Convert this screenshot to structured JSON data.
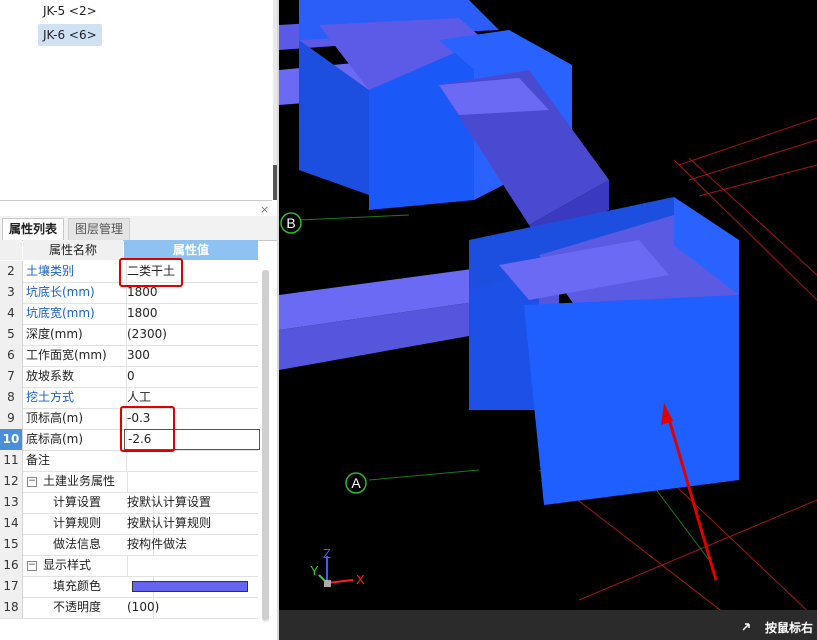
{
  "tree": {
    "items": [
      {
        "label": "JK-5 <2>",
        "selected": false
      },
      {
        "label": "JK-6 <6>",
        "selected": true
      }
    ]
  },
  "tabs": [
    {
      "label": "属性列表",
      "active": true
    },
    {
      "label": "图层管理",
      "active": false
    }
  ],
  "panel": {
    "close_icon": "×"
  },
  "table": {
    "header": {
      "name": "属性名称",
      "value": "属性值"
    },
    "rows": [
      {
        "num": "2",
        "name": "土壤类别",
        "value": "二类干土"
      },
      {
        "num": "3",
        "name": "坑底长(mm)",
        "value": "1800"
      },
      {
        "num": "4",
        "name": "坑底宽(mm)",
        "value": "1800"
      },
      {
        "num": "5",
        "name": "深度(mm)",
        "value": "(2300)"
      },
      {
        "num": "6",
        "name": "工作面宽(mm)",
        "value": "300"
      },
      {
        "num": "7",
        "name": "放坡系数",
        "value": "0"
      },
      {
        "num": "8",
        "name": "挖土方式",
        "value": "人工"
      },
      {
        "num": "9",
        "name": "顶标高(m)",
        "value": "-0.3"
      },
      {
        "num": "10",
        "name": "底标高(m)",
        "value": "-2.6"
      },
      {
        "num": "11",
        "name": "备注",
        "value": ""
      },
      {
        "num": "12",
        "name": "土建业务属性",
        "value": ""
      },
      {
        "num": "13",
        "name": "计算设置",
        "value": "按默认计算设置"
      },
      {
        "num": "14",
        "name": "计算规则",
        "value": "按默认计算规则"
      },
      {
        "num": "15",
        "name": "做法信息",
        "value": "按构件做法"
      },
      {
        "num": "16",
        "name": "显示样式",
        "value": ""
      },
      {
        "num": "17",
        "name": "填充颜色",
        "value": ""
      },
      {
        "num": "18",
        "name": "不透明度",
        "value": "(100)"
      }
    ],
    "selected_row": "10",
    "fill_color": "#6464f0"
  },
  "viewport": {
    "axis_labels": {
      "b": "B",
      "a": "A"
    },
    "gizmo": {
      "x": "X",
      "y": "Y",
      "z": "Z"
    },
    "status_text": "按鼠标右"
  },
  "colors": {
    "accent_blue": "#4a90d9",
    "annotation_red": "#e00000",
    "pit_blue": "#1f5fff",
    "trench_purple": "#6464f0"
  }
}
